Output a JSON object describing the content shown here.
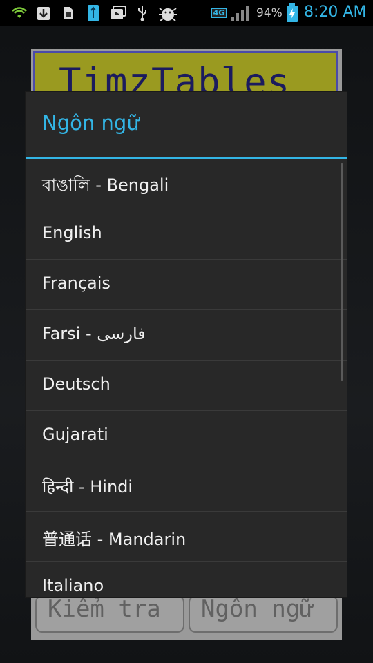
{
  "status_bar": {
    "network": "4G",
    "battery_percent": "94%",
    "time": "8:20 AM",
    "icons": [
      "wifi-icon",
      "download-icon",
      "sim-toolkit-icon",
      "usb-storage-icon",
      "video-play-icon",
      "usb-icon",
      "android-debug-icon",
      "signal-icon",
      "battery-charging-icon"
    ]
  },
  "background_app": {
    "title": "TimzTables",
    "buttons": [
      "Kiểm tra",
      "Ngôn ngữ"
    ]
  },
  "dialog": {
    "title": "Ngôn ngữ",
    "items": [
      {
        "label": "বাঙালি - Bengali"
      },
      {
        "label": "English"
      },
      {
        "label": "Français"
      },
      {
        "label": "Farsi - فارسی"
      },
      {
        "label": "Deutsch"
      },
      {
        "label": "Gujarati"
      },
      {
        "label": "हिन्दी - Hindi"
      },
      {
        "label": "普通话 - Mandarin"
      },
      {
        "label": "Italiano"
      }
    ]
  },
  "colors": {
    "accent": "#33b5e5",
    "dialog_bg": "#282828",
    "item_text": "#f0f0f0"
  }
}
